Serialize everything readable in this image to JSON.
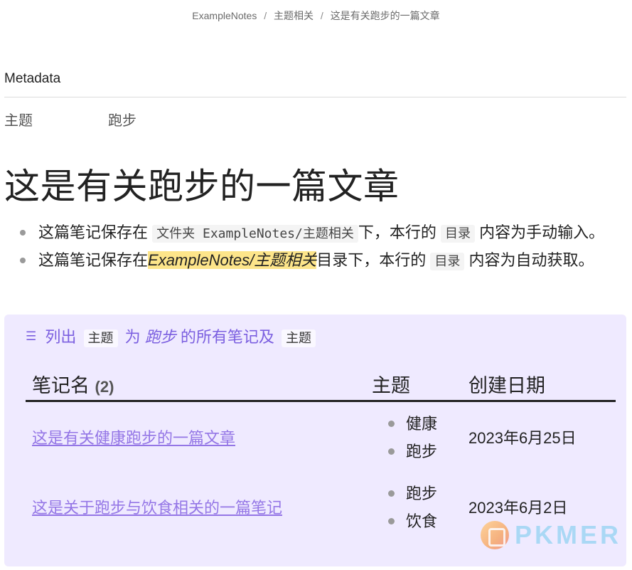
{
  "breadcrumb": {
    "items": [
      "ExampleNotes",
      "主题相关",
      "这是有关跑步的一篇文章"
    ],
    "separator": "/"
  },
  "metadata": {
    "header": "Metadata",
    "key": "主题",
    "value": "跑步"
  },
  "title": "这是有关跑步的一篇文章",
  "bullets": [
    {
      "before": "这篇笔记保存在",
      "code1": "文件夹 ExampleNotes/主题相关",
      "middle": "下，本行的",
      "code2": "目录",
      "after": "内容为手动输入。"
    },
    {
      "before": "这篇笔记保存在",
      "highlight": "ExampleNotes/主题相关",
      "middle": "目录下，本行的",
      "code2": "目录",
      "after": "内容为自动获取。"
    }
  ],
  "query": {
    "icon": "list-icon",
    "prefix": "列出",
    "chip1": "主题",
    "middle": "为",
    "em": "跑步",
    "suffix": "的所有笔记及",
    "chip2": "主题",
    "table": {
      "col1": "笔记名",
      "count": "(2)",
      "col2": "主题",
      "col3": "创建日期",
      "rows": [
        {
          "name": "这是有关健康跑步的一篇文章",
          "topics": [
            "健康",
            "跑步"
          ],
          "date": "2023年6月25日"
        },
        {
          "name": "这是关于跑步与饮食相关的一篇笔记",
          "topics": [
            "跑步",
            "饮食"
          ],
          "date": "2023年6月2日"
        }
      ]
    }
  },
  "watermark": {
    "text": "PKMER",
    "icon": "pkmer-logo-icon"
  },
  "colors": {
    "accent": "#7b5fe0",
    "link": "#9476e6",
    "query_background": "#efeaff",
    "highlight": "#fde58a"
  }
}
